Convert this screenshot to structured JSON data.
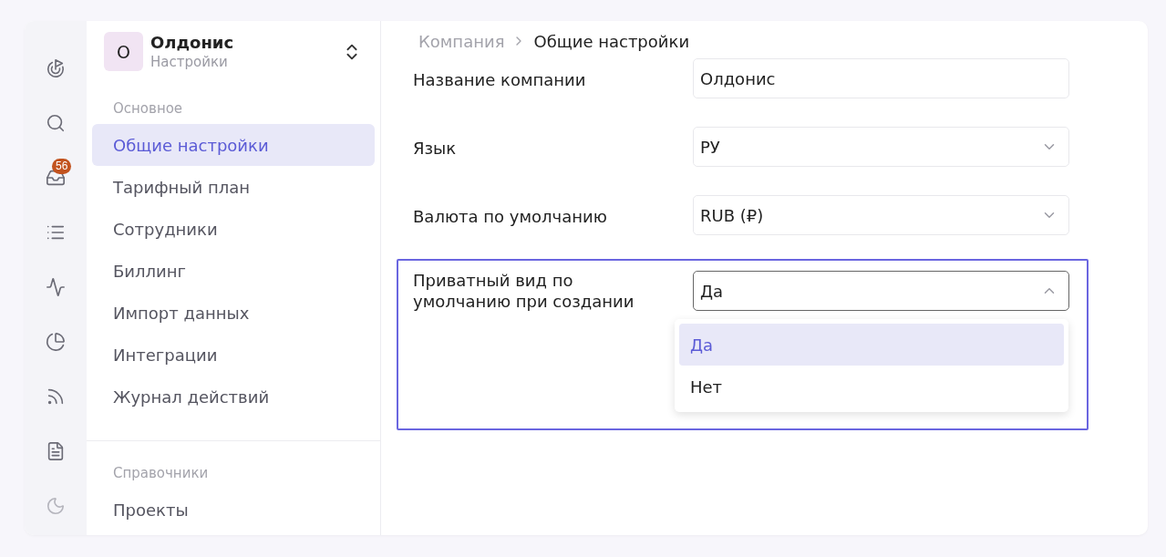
{
  "rail": {
    "items": [
      {
        "selected": false
      },
      {
        "selected": false
      },
      {
        "selected": false,
        "badge": "56"
      },
      {
        "selected": false
      },
      {
        "selected": false
      },
      {
        "selected": false
      },
      {
        "selected": false
      },
      {
        "selected": false
      },
      {
        "selected": false
      }
    ]
  },
  "workspace": {
    "avatar": "О",
    "name": "Олдонис",
    "subtitle": "Настройки"
  },
  "sidebar": {
    "sections": [
      {
        "title": "Основное",
        "items": [
          {
            "label": "Общие настройки",
            "selected": true
          },
          {
            "label": "Тарифный план",
            "selected": false
          },
          {
            "label": "Сотрудники",
            "selected": false
          },
          {
            "label": "Биллинг",
            "selected": false
          },
          {
            "label": "Импорт данных",
            "selected": false
          },
          {
            "label": "Интеграции",
            "selected": false
          },
          {
            "label": "Журнал действий",
            "selected": false
          }
        ]
      },
      {
        "title": "Справочники",
        "items": [
          {
            "label": "Проекты",
            "selected": false
          }
        ]
      }
    ]
  },
  "breadcrumb": [
    {
      "label": "Компания",
      "current": false
    },
    {
      "label": "Общие настройки",
      "current": true
    }
  ],
  "fields": [
    {
      "label": "Название компании",
      "kind": "text",
      "value": "Олдонис",
      "focused": false
    },
    {
      "label": "Язык",
      "kind": "select",
      "value": "РУ",
      "focused": false,
      "expanded": false
    },
    {
      "label": "Валюта по умолчанию",
      "kind": "select",
      "value": "RUB (₽)",
      "focused": false,
      "expanded": false
    },
    {
      "label": "Приватный вид по умолчанию при создании",
      "kind": "select",
      "value": "Да",
      "focused": true,
      "expanded": true,
      "options": [
        {
          "label": "Да",
          "selected": true
        },
        {
          "label": "Нет",
          "selected": false
        }
      ]
    }
  ]
}
